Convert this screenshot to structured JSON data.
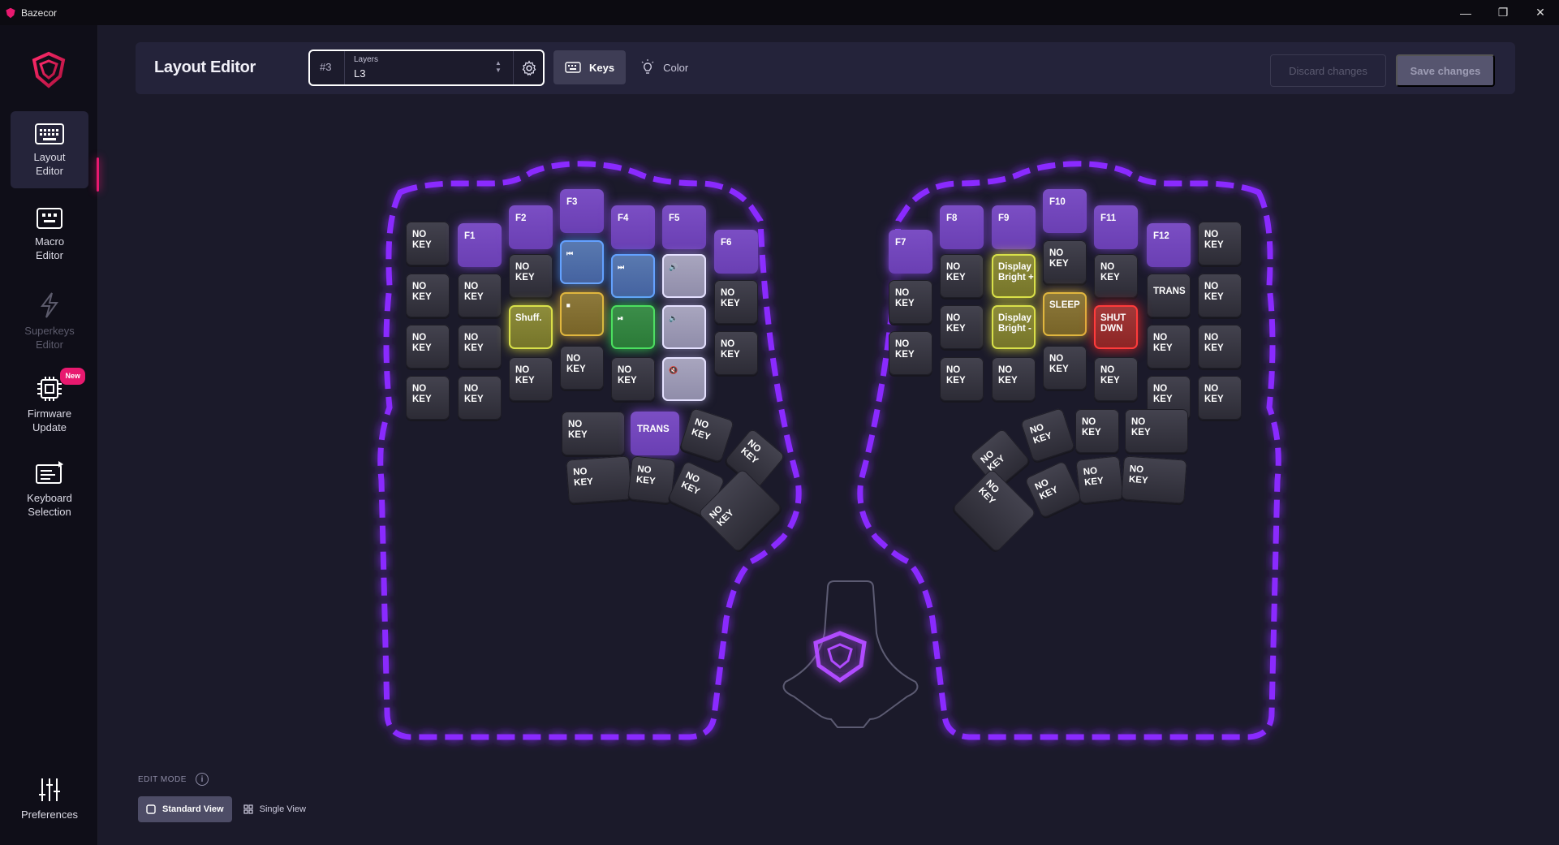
{
  "window": {
    "title": "Bazecor",
    "minimize": "—",
    "restore": "❐",
    "close": "✕"
  },
  "sidebar": {
    "items": [
      {
        "label_line1": "Layout",
        "label_line2": "Editor",
        "icon": "keyboard-icon"
      },
      {
        "label_line1": "Macro",
        "label_line2": "Editor",
        "icon": "macro-icon"
      },
      {
        "label_line1": "Superkeys",
        "label_line2": "Editor",
        "icon": "lightning-icon"
      },
      {
        "label_line1": "Firmware",
        "label_line2": "Update",
        "icon": "chip-icon",
        "badge": "New"
      },
      {
        "label_line1": "Keyboard",
        "label_line2": "Selection",
        "icon": "keyboard-select-icon"
      }
    ],
    "preferences": "Preferences"
  },
  "header": {
    "title": "Layout Editor",
    "layer_number": "#3",
    "layer_label": "Layers",
    "layer_value": "L3",
    "tab_keys": "Keys",
    "tab_color": "Color",
    "discard": "Discard changes",
    "save": "Save changes"
  },
  "keys": {
    "no_key_1": "NO",
    "no_key_2": "KEY",
    "trans": "TRANS",
    "shuffle": "Shuff.",
    "display_bright_plus_1": "Display",
    "display_bright_plus_2": "Bright +",
    "display_bright_minus_1": "Display",
    "display_bright_minus_2": "Bright -",
    "sleep": "SLEEP",
    "shutdown_1": "SHUT",
    "shutdown_2": "DWN",
    "f1": "F1",
    "f2": "F2",
    "f3": "F3",
    "f4": "F4",
    "f5": "F5",
    "f6": "F6",
    "f7": "F7",
    "f8": "F8",
    "f9": "F9",
    "f10": "F10",
    "f11": "F11",
    "f12": "F12"
  },
  "colors": {
    "accent": "#e8196f",
    "underglow": "#8a2cff",
    "function_key": "#7b4ec4",
    "blue_key": "#4f8cff",
    "yellow_key": "#d8e04a",
    "orange_key": "#e0b63e",
    "green_key": "#4be05f",
    "lavender_key": "#e5e1ff",
    "red_key": "#ff3b3b"
  },
  "footer": {
    "edit_mode": "EDIT MODE",
    "standard_view": "Standard View",
    "single_view": "Single View"
  }
}
